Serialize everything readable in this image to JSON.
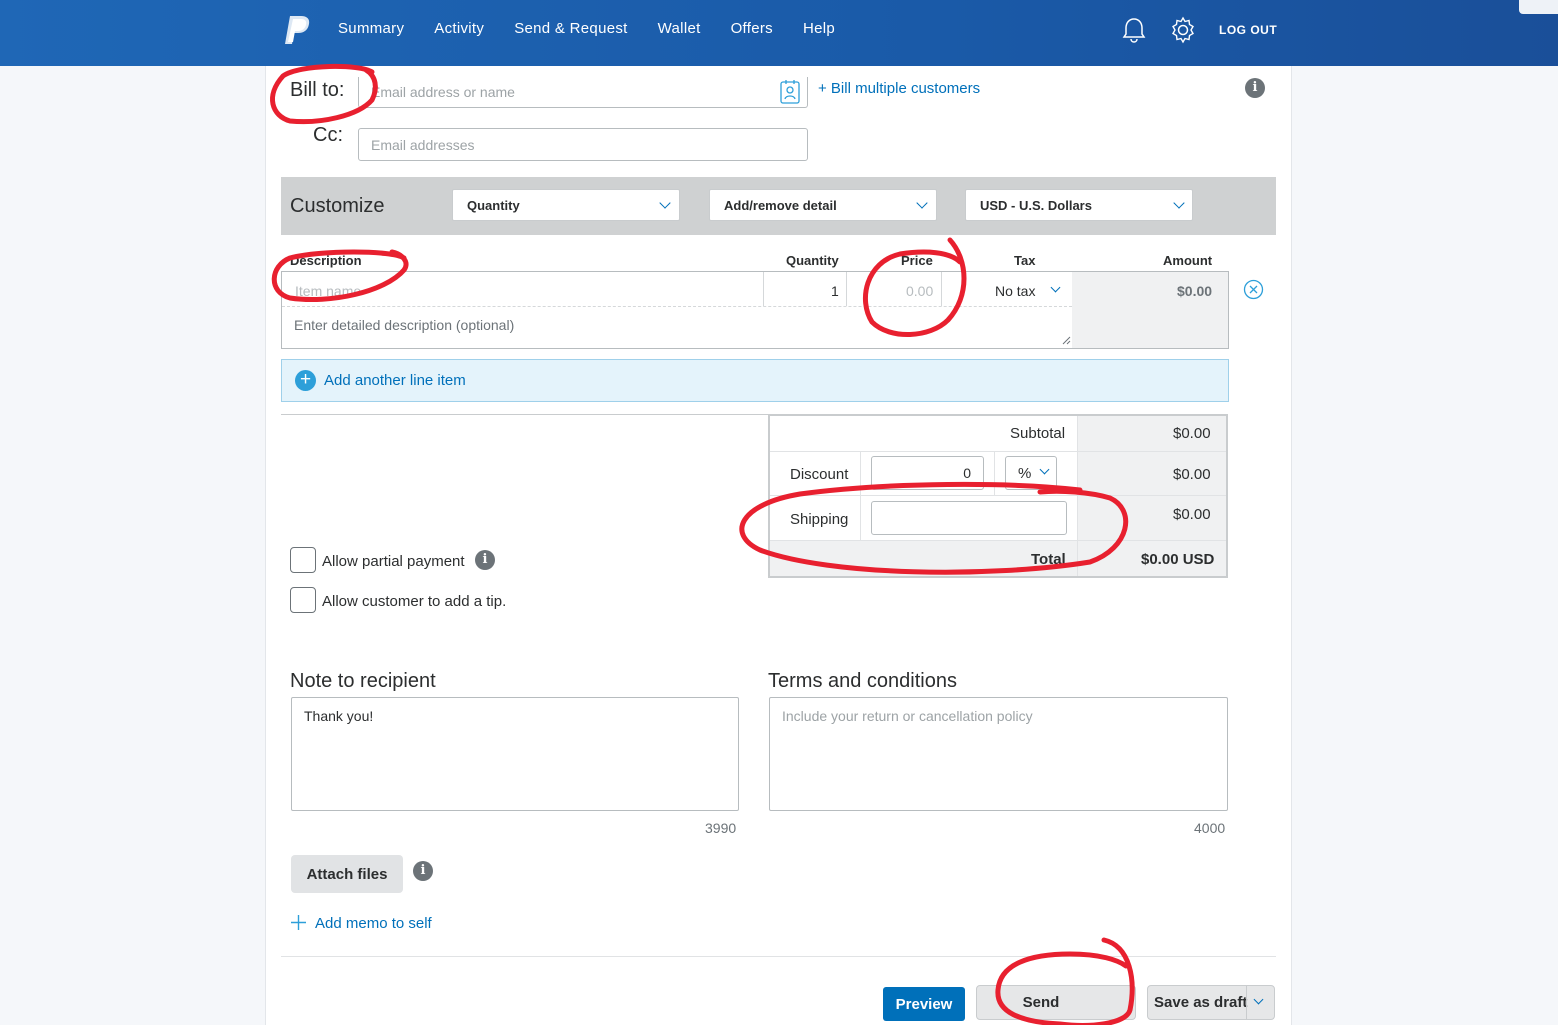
{
  "header": {
    "nav": [
      "Summary",
      "Activity",
      "Send & Request",
      "Wallet",
      "Offers",
      "Help"
    ],
    "logout": "LOG OUT",
    "brand_color": "#1f67b6"
  },
  "bill_to": {
    "label": "Bill to:",
    "placeholder": "Email address or name",
    "multiple_link": "+ Bill multiple customers"
  },
  "cc": {
    "label": "Cc:",
    "placeholder": "Email addresses"
  },
  "customize": {
    "label": "Customize",
    "quantity_select": "Quantity",
    "detail_select": "Add/remove detail",
    "currency_select": "USD - U.S. Dollars"
  },
  "line_items": {
    "headers": {
      "description": "Description",
      "quantity": "Quantity",
      "price": "Price",
      "tax": "Tax",
      "amount": "Amount"
    },
    "item_name_placeholder": "Item name",
    "quantity_value": "1",
    "price_placeholder": "0.00",
    "tax_value": "No tax",
    "amount_value": "$0.00",
    "description_placeholder": "Enter detailed description (optional)",
    "add_line": "Add another line item"
  },
  "totals": {
    "subtotal_label": "Subtotal",
    "subtotal_value": "$0.00",
    "discount_label": "Discount",
    "discount_input": "0",
    "discount_unit": "%",
    "discount_value": "$0.00",
    "shipping_label": "Shipping",
    "shipping_value": "$0.00",
    "total_label": "Total",
    "total_value": "$0.00 USD"
  },
  "options": {
    "partial_payment": "Allow partial payment",
    "tip": "Allow customer to add a tip."
  },
  "note": {
    "label": "Note to recipient",
    "value": "Thank you!",
    "counter": "3990"
  },
  "terms": {
    "label": "Terms and conditions",
    "placeholder": "Include your return or cancellation policy",
    "counter": "4000"
  },
  "attach": {
    "label": "Attach files"
  },
  "memo": {
    "label": "Add memo to self"
  },
  "actions": {
    "preview": "Preview",
    "send": "Send",
    "save_draft": "Save as draft"
  }
}
